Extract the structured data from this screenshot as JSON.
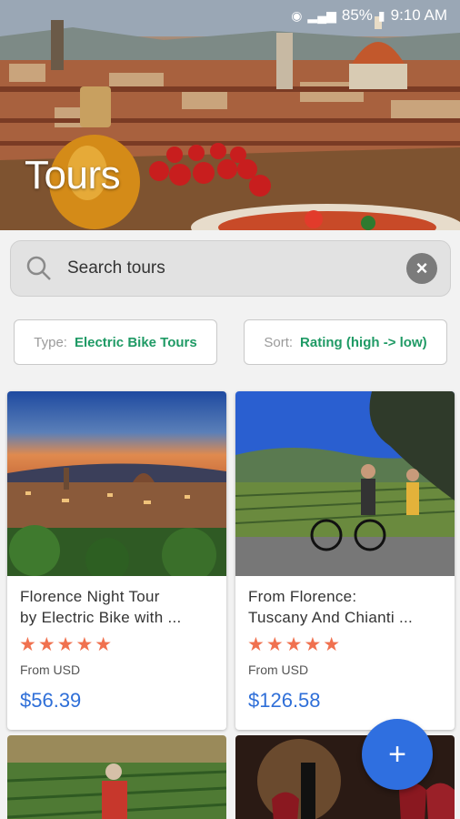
{
  "status_bar": {
    "battery": "85%",
    "time": "9:10 AM"
  },
  "header": {
    "title": "Tours"
  },
  "search": {
    "placeholder": "Search tours"
  },
  "filters": {
    "type": {
      "label": "Type:",
      "value": "Electric Bike Tours"
    },
    "sort": {
      "label": "Sort:",
      "value": "Rating (high -> low)"
    }
  },
  "tours": [
    {
      "title_line1": "Florence Night Tour",
      "title_line2": "by Electric Bike with ...",
      "stars": "★★★★★",
      "price_prefix": "From USD",
      "price": "$56.39"
    },
    {
      "title_line1": "From Florence:",
      "title_line2": "Tuscany And Chianti ...",
      "stars": "★★★★★",
      "price_prefix": "From USD",
      "price": "$126.58"
    }
  ],
  "fab": {
    "label": "+"
  },
  "colors": {
    "accent_green": "#1f9a65",
    "price_blue": "#2f6fd8",
    "star_orange": "#f0714f",
    "fab_blue": "#2f6fe0"
  }
}
